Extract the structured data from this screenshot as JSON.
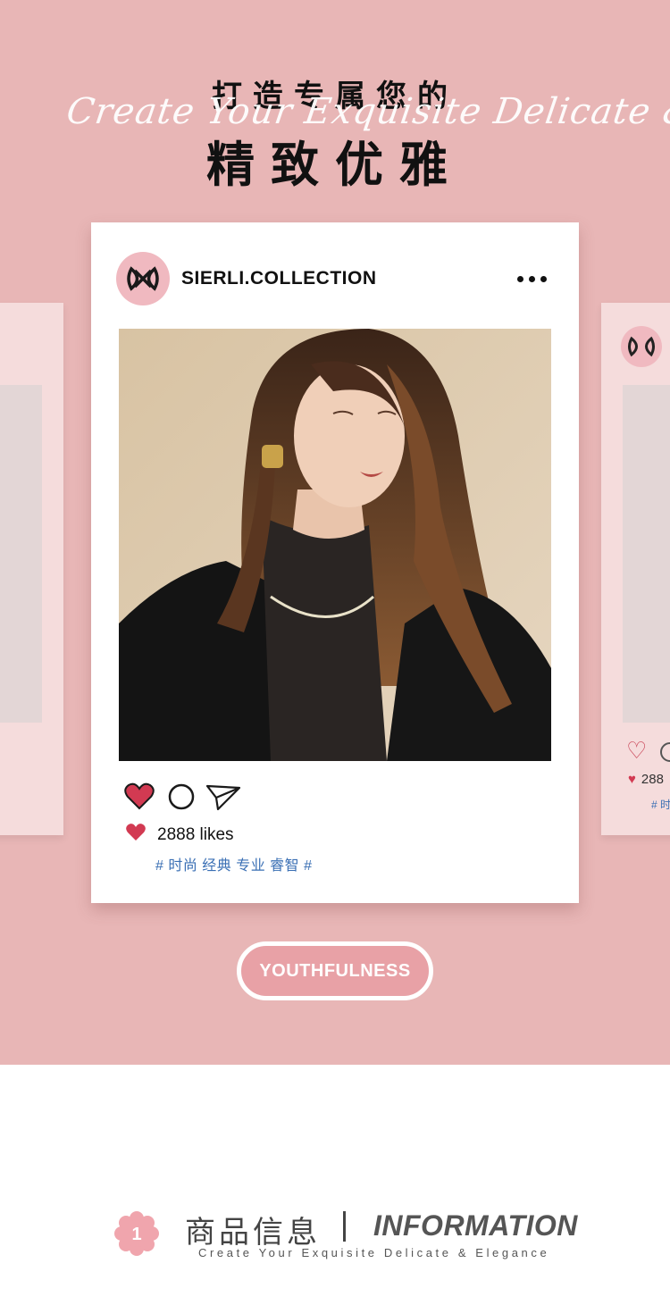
{
  "hero": {
    "title_top": "打造专属您的",
    "script_line": "Create Your Exquisite Delicate & Elegance",
    "title_main": "精致优雅"
  },
  "post": {
    "username": "SIERLI.COLLECTION",
    "likes": "2888 likes",
    "tags": "# 时尚 经典 专业 睿智 #",
    "logo_icon": "brand-logo-icon",
    "more_icon": "more-dots-icon"
  },
  "side_card_right": {
    "likes_partial": "288",
    "tags_partial": "# 时"
  },
  "actions": {
    "like_icon": "heart-icon",
    "comment_icon": "comment-icon",
    "share_icon": "send-icon"
  },
  "button": {
    "label": "YOUTHFULNESS"
  },
  "section": {
    "number": "1",
    "title_cn": "商品信息",
    "title_en": "INFORMATION",
    "subtitle": "Create Your Exquisite Delicate & Elegance"
  },
  "colors": {
    "hero_bg": "#e8b6b6",
    "card_bg": "#ffffff",
    "accent_pink": "#e8a1a6",
    "heart_red": "#d23a52",
    "tag_blue": "#3a6fb4"
  }
}
